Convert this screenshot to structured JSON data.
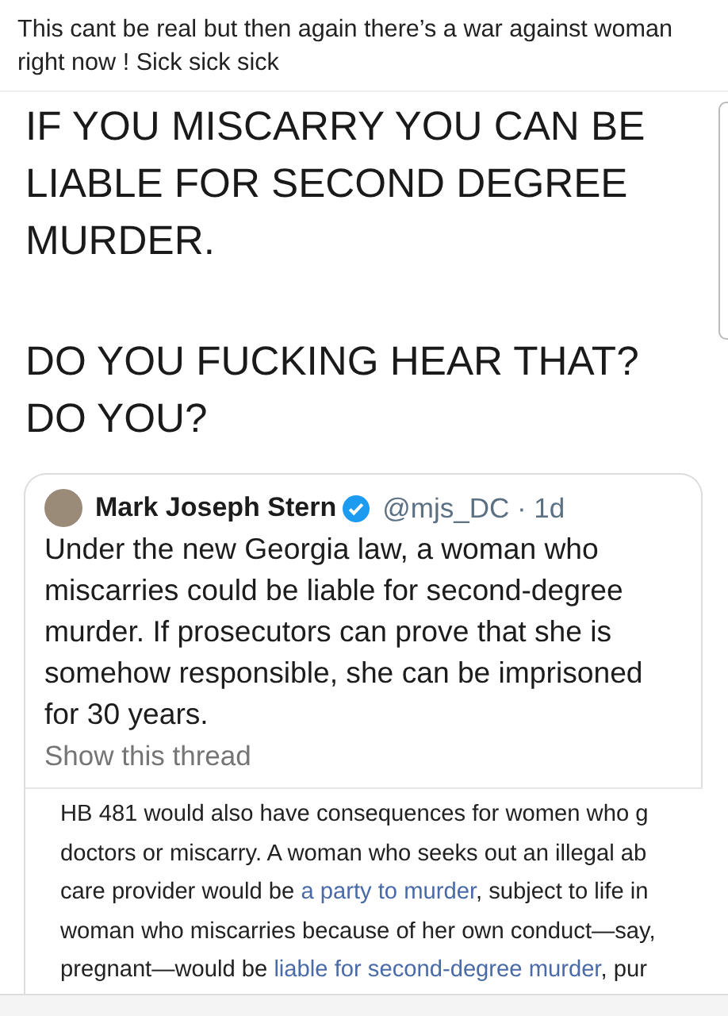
{
  "post": {
    "caption": "This cant be real but then again there’s a war against woman right now ! Sick sick sick"
  },
  "shared_image": {
    "headline_paragraphs": [
      "IF YOU MISCARRY YOU CAN BE LIABLE FOR SECOND DEGREE MURDER.",
      "DO YOU FUCKING HEAR THAT? DO YOU?"
    ],
    "quoted_tweet": {
      "author": "Mark Joseph Stern",
      "verified": true,
      "handle_and_time": "@mjs_DC · 1d",
      "text": "Under the new Georgia law, a woman who miscarries could be liable for second-degree murder. If prosecutors can prove that she is somehow responsible, she can be imprisoned for 30 years.",
      "show_thread": "Show this thread"
    },
    "article_excerpt": {
      "lines": [
        [
          {
            "text": "HB 481 would also have consequences for women who g",
            "link": false
          }
        ],
        [
          {
            "text": "doctors or miscarry. A woman who seeks out an illegal ab",
            "link": false
          }
        ],
        [
          {
            "text": "care provider would be ",
            "link": false
          },
          {
            "text": "a party to murder",
            "link": true
          },
          {
            "text": ", subject to life in",
            "link": false
          }
        ],
        [
          {
            "text": "woman who miscarries because of her own conduct—say,",
            "link": false
          }
        ],
        [
          {
            "text": "pregnant—would be ",
            "link": false
          },
          {
            "text": "liable for second-degree murder",
            "link": true
          },
          {
            "text": ", pur",
            "link": false
          }
        ]
      ]
    }
  }
}
